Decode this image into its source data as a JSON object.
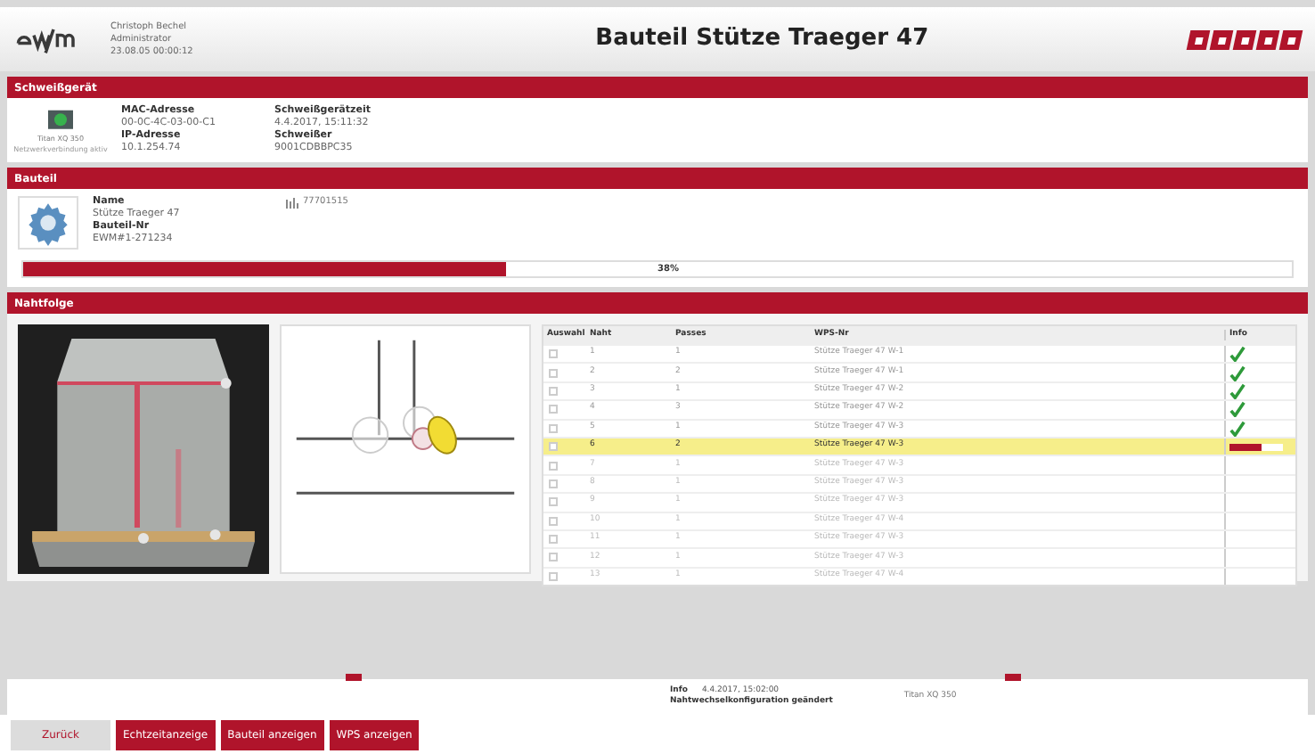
{
  "header": {
    "user": "Christoph Bechel",
    "role": "Administrator",
    "time": "23.08.05 00:00:12",
    "title": "Bauteil Stütze Traeger 47"
  },
  "device_section": {
    "title": "Schweißgerät",
    "device_name": "Titan XQ 350",
    "device_sub": "Netzwerkverbindung aktiv",
    "fields": [
      {
        "label": "MAC-Adresse",
        "value": "00-0C-4C-03-00-C1"
      },
      {
        "label": "Schweißgerätzeit",
        "value": "4.4.2017, 15:11:32"
      },
      {
        "label": "IP-Adresse",
        "value": "10.1.254.74"
      },
      {
        "label": "Schweißer",
        "value": "9001CDBBPC35"
      }
    ]
  },
  "part_section": {
    "title": "Bauteil",
    "fields": [
      {
        "label": "Name",
        "value": "Stütze Traeger 47"
      },
      {
        "label": "Bauteil-Nr",
        "value": "EWM#1-271234"
      }
    ],
    "barcode": "77701515",
    "progress": {
      "level": 0.38,
      "reading": "38%"
    }
  },
  "seam_section": {
    "title": "Nahtfolge",
    "columns": [
      "Auswahl",
      "Naht",
      "Passes",
      "WPS-Nr",
      "Info"
    ],
    "rows": [
      {
        "naht": "1",
        "passes": "1",
        "wps": "Stütze Traeger 47 W-1",
        "kind": "done",
        "selected": false
      },
      {
        "naht": "2",
        "passes": "2",
        "wps": "Stütze Traeger 47 W-1",
        "kind": "done",
        "selected": false
      },
      {
        "naht": "3",
        "passes": "1",
        "wps": "Stütze Traeger 47 W-2",
        "kind": "done",
        "selected": false
      },
      {
        "naht": "4",
        "passes": "3",
        "wps": "Stütze Traeger 47 W-2",
        "kind": "done",
        "selected": false
      },
      {
        "naht": "5",
        "passes": "1",
        "wps": "Stütze Traeger 47 W-3",
        "kind": "done",
        "selected": false
      },
      {
        "naht": "6",
        "passes": "2",
        "wps": "Stütze Traeger 47 W-3",
        "kind": "active",
        "selected": true,
        "level": 0.6
      },
      {
        "naht": "7",
        "passes": "1",
        "wps": "Stütze Traeger 47 W-3",
        "kind": "open",
        "selected": false
      },
      {
        "naht": "8",
        "passes": "1",
        "wps": "Stütze Traeger 47 W-3",
        "kind": "open",
        "selected": false
      },
      {
        "naht": "9",
        "passes": "1",
        "wps": "Stütze Traeger 47 W-3",
        "kind": "open",
        "selected": false
      },
      {
        "naht": "10",
        "passes": "1",
        "wps": "Stütze Traeger 47 W-4",
        "kind": "open",
        "selected": false
      },
      {
        "naht": "11",
        "passes": "1",
        "wps": "Stütze Traeger 47 W-3",
        "kind": "open",
        "selected": false
      },
      {
        "naht": "12",
        "passes": "1",
        "wps": "Stütze Traeger 47 W-3",
        "kind": "open",
        "selected": false
      },
      {
        "naht": "13",
        "passes": "1",
        "wps": "Stütze Traeger 47 W-4",
        "kind": "open",
        "selected": false
      }
    ]
  },
  "info_bar": {
    "label": "Info",
    "time": "4.4.2017, 15:02:00",
    "message": "Nahtwechselkonfiguration geändert",
    "device": "Titan XQ 350"
  },
  "buttons": [
    {
      "label": "Zurück",
      "kind": "secondary"
    },
    {
      "label": "Echtzeitanzeige",
      "kind": "primary"
    },
    {
      "label": "Bauteil anzeigen",
      "kind": "primary"
    },
    {
      "label": "WPS anzeigen",
      "kind": "primary"
    }
  ]
}
